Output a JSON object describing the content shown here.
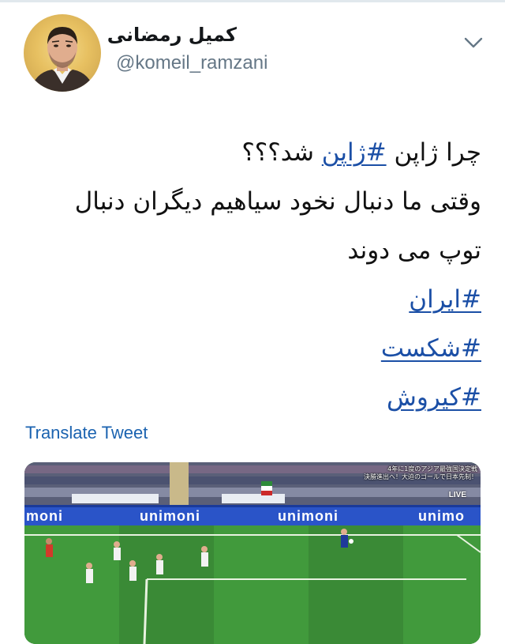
{
  "tweet": {
    "display_name": "کمیل رمضانی",
    "handle": "@komeil_ramzani",
    "menu_icon": "chevron-down-icon",
    "line1_prefix": "چرا ژاپن ",
    "line1_hashtag": "#ژاپن",
    "line1_suffix": " شد؟؟؟",
    "line2": "وقتی ما دنبال نخود سیاهیم دیگران دنبال",
    "line3": "توپ می دوند",
    "hashtags": [
      "#ایران",
      "#شکست",
      "#کیروش"
    ],
    "translate_label": "Translate Tweet",
    "link_color": "#1b4fa6"
  },
  "media": {
    "overlay_line1": "4年に1度のアジア最強国決定戦",
    "overlay_line2": "決勝進出へ！大迫のゴールで日本先制！",
    "live_label": "LIVE",
    "ad_board_text": [
      "moni",
      "unimoni",
      "unimoni",
      "unimo"
    ]
  }
}
